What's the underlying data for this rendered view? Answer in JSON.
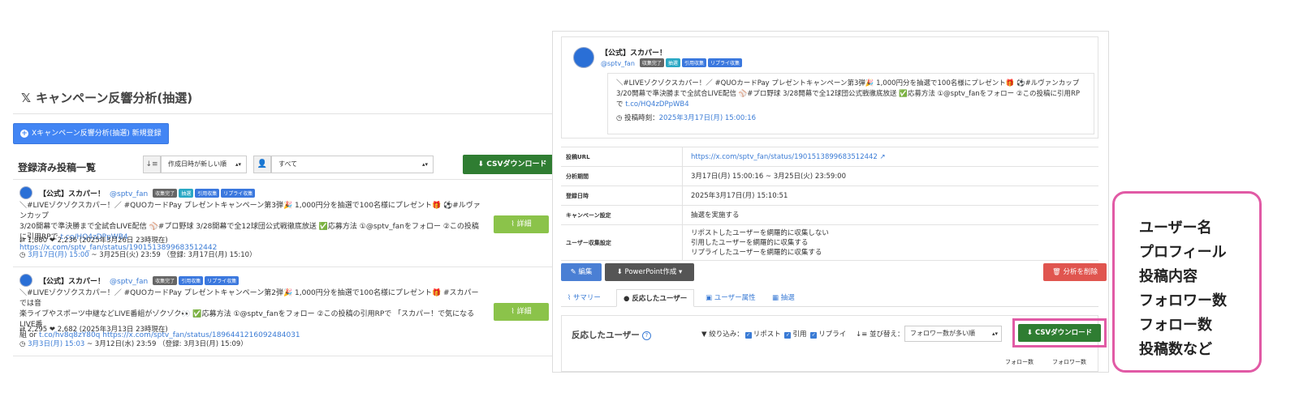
{
  "left": {
    "page_title": "キャンペーン反響分析(抽選)",
    "x_logo": "𝕏",
    "new_button": "Xキャンペーン反響分析(抽選) 新規登録",
    "list_title": "登録済み投稿一覧",
    "sort_select": "作成日時が新しい順",
    "filter_select": "すべて",
    "csv_button": "CSVダウンロード",
    "posts": [
      {
        "name": "【公式】スカパー！",
        "handle": "@sptv_fan",
        "badges": [
          "収集完了",
          "抽選",
          "引用収集",
          "リプライ収集"
        ],
        "body_a": "＼#LIVEゾクゾクスカパー！／ #QUOカードPay プレゼントキャンペーン第3弾🎉 1,000円分を抽選で100名様にプレゼント🎁 ⚽#ルヴァンカップ",
        "body_b": "3/20開幕で準決勝まで全試合LIVE配信 ⚾#プロ野球 3/28開幕で全12球団公式戦徹底放送 ✅応募方法 ①@sptv_fanをフォロー ②この投稿に引用RPで ",
        "body_link1": "t.co/HQ4zDPpWB4",
        "body_link2": "https://x.com/sptv_fan/status/1901513899683512442",
        "stats": "1,880 ❤ 2,236 (2025年3月26日 23時現在)",
        "period_link": "3月17日(月) 15:00",
        "period_rest": " ~ 3月25日(火) 23:59 （登録: 3月17日(月) 15:10）",
        "detail": "詳細"
      },
      {
        "name": "【公式】スカパー！",
        "handle": "@sptv_fan",
        "badges": [
          "収集完了",
          "引用収集",
          "リプライ収集"
        ],
        "body_a": "＼#LIVEゾクゾクスカパー！／ #QUOカードPay プレゼントキャンペーン第2弾🎉 1,000円分を抽選で100名様にプレゼント🎁 #スカパー では音",
        "body_b": "楽ライブやスポーツ中継などLIVE番組がゾクゾク👀 ✅応募方法 ①@sptv_fanをフォロー ②この投稿の引用RPで 「スカパー！で気になるLIVE番",
        "body_c": "組 or ",
        "body_link1": "t.co/hv8q8zY80q",
        "body_link2": "https://x.com/sptv_fan/status/1896441216092484031",
        "stats": "2,295 ❤ 2,682 (2025年3月13日 23時現在)",
        "period_link": "3月3日(月) 15:03",
        "period_rest": " ~ 3月12日(水) 23:59 （登録: 3月3日(月) 15:09）",
        "detail": "詳細"
      }
    ]
  },
  "right": {
    "name": "【公式】スカパー！",
    "handle": "@sptv_fan",
    "badges": [
      "収集完了",
      "抽選",
      "引用収集",
      "リプライ収集"
    ],
    "body_1": "＼#LIVEゾクゾクスカパー！／ #QUOカードPay プレゼントキャンペーン第3弾🎉 1,000円分を抽選で100名様にプレゼント🎁 ⚽#ルヴァンカップ",
    "body_2": "3/20開幕で準決勝まで全試合LIVE配信 ⚾#プロ野球 3/28開幕で全12球団公式戦徹底放送 ✅応募方法 ①@sptv_fanをフォロー ②この投稿に引用RP",
    "body_3": "で ",
    "body_link": "t.co/HQ4zDPpWB4",
    "post_time_label": "投稿時刻：",
    "post_time": "2025年3月17日(月) 15:00:16",
    "info": {
      "url_label": "投稿URL",
      "url": "https://x.com/sptv_fan/status/1901513899683512442",
      "period_label": "分析期間",
      "period": "3月17日(月) 15:00:16 ~ 3月25日(火) 23:59:00",
      "registered_label": "登録日時",
      "registered": "2025年3月17日(月) 15:10:51",
      "campaign_label": "キャンペーン設定",
      "campaign": "抽選を実施する",
      "collect_label": "ユーザー収集設定",
      "collect_1": "リポストしたユーザーを網羅的に収集しない",
      "collect_2": "引用したユーザーを網羅的に収集する",
      "collect_3": "リプライしたユーザーを網羅的に収集する"
    },
    "buttons": {
      "edit": "編集",
      "ppt": "PowerPoint作成",
      "delete": "分析を削除"
    },
    "tabs": [
      "サマリー",
      "反応したユーザー",
      "ユーザー属性",
      "抽選"
    ],
    "react": {
      "title": "反応したユーザー",
      "filter_label": "絞り込み：",
      "f1": "リポスト",
      "f2": "引用",
      "f3": "リプライ",
      "sort_label": "並び替え：",
      "sort_value": "フォロワー数が多い順",
      "csv": "CSVダウンロード",
      "col1": "フォロー数",
      "col2": "フォロワー数"
    }
  },
  "callout": [
    "ユーザー名",
    "プロフィール",
    "投稿内容",
    "フォロワー数",
    "フォロー数",
    "投稿数など"
  ],
  "colors": {
    "accent_pink": "#e15aa5",
    "primary_blue": "#4285f4",
    "csv_green": "#2f7d32",
    "detail_green": "#8bc34a",
    "danger_red": "#e0554f"
  }
}
